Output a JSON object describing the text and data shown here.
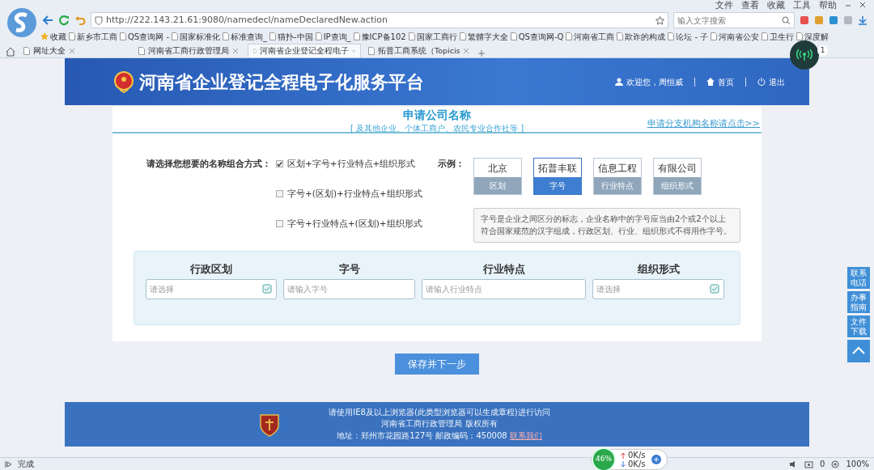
{
  "browser": {
    "menu": [
      "文件",
      "查看",
      "收藏",
      "工具",
      "帮助"
    ],
    "url": "http://222.143.21.61:9080/namedecl/nameDeclaredNew.action",
    "search_placeholder": "输入文字搜索",
    "favorites_label": "收藏",
    "bookmarks": [
      "新乡市工商",
      "QS查询网 -",
      "国家标准化",
      "标准查询_",
      "猫扑-中国",
      "IP查询_",
      "豫ICP备102",
      "国家工商行",
      "繁體字大全",
      "QS查询网-Q",
      "河南省工商",
      "欺诈的构成",
      "论坛 - 子",
      "河南省公安",
      "卫生行",
      "深度解"
    ],
    "tabs": [
      {
        "label": "网址大全",
        "selected": false
      },
      {
        "label": "河南省工商行政管理局",
        "selected": false
      },
      {
        "label": "河南省企业登记全程电子",
        "selected": true
      },
      {
        "label": "拓普工商系统（Topicis",
        "selected": false
      }
    ],
    "notification_badge": "1"
  },
  "page": {
    "site_title": "河南省企业登记全程电子化服务平台",
    "user_links": [
      "欢迎您，周恒威",
      "首页",
      "退出"
    ],
    "heading": "申请公司名称",
    "subheading": "[ 及其他企业、个体工商户、农民专业合作社等 ]",
    "branch_link": "申请分支机构名称请点击>>",
    "combination_label": "请选择您想要的名称组合方式：",
    "combinations": [
      {
        "label": "区划+字号+行业特点+组织形式",
        "checked": true
      },
      {
        "label": "字号+(区划)+行业特点+组织形式",
        "checked": false
      },
      {
        "label": "字号+行业特点+(区划)+组织形式",
        "checked": false
      }
    ],
    "example_label": "示例：",
    "examples": [
      {
        "word": "北京",
        "part": "区划",
        "selected": false
      },
      {
        "word": "拓普丰联",
        "part": "字号",
        "selected": true
      },
      {
        "word": "信息工程",
        "part": "行业特点",
        "selected": false
      },
      {
        "word": "有限公司",
        "part": "组织形式",
        "selected": false
      }
    ],
    "tooltip": "字号是企业之间区分的标志，企业名称中的字号应当由2个或2个以上符合国家规范的汉字组成，行政区划、行业、组织形式不得用作字号。",
    "fields": [
      {
        "label": "行政区划",
        "kind": "select",
        "placeholder": "请选择"
      },
      {
        "label": "字号",
        "kind": "text",
        "placeholder": "请输入字号"
      },
      {
        "label": "行业特点",
        "kind": "text",
        "placeholder": "请输入行业特点"
      },
      {
        "label": "组织形式",
        "kind": "select",
        "placeholder": "请选择"
      }
    ],
    "save_button": "保存并下一步",
    "side_links": [
      "联系电话",
      "办事指南",
      "文件下载"
    ],
    "footer": {
      "lines": [
        "请使用IE8及以上浏览器(此类型浏览器可以生成章程)进行访问",
        "河南省工商行政管理局 版权所有",
        "地址：郑州市花园路127号 邮政编码：450008"
      ],
      "link": "联系我们"
    }
  },
  "status_bar": {
    "text": "完成",
    "meter": "46%",
    "upload": "0K/s",
    "download": "0K/s",
    "count": "0",
    "zoom": "100%"
  }
}
